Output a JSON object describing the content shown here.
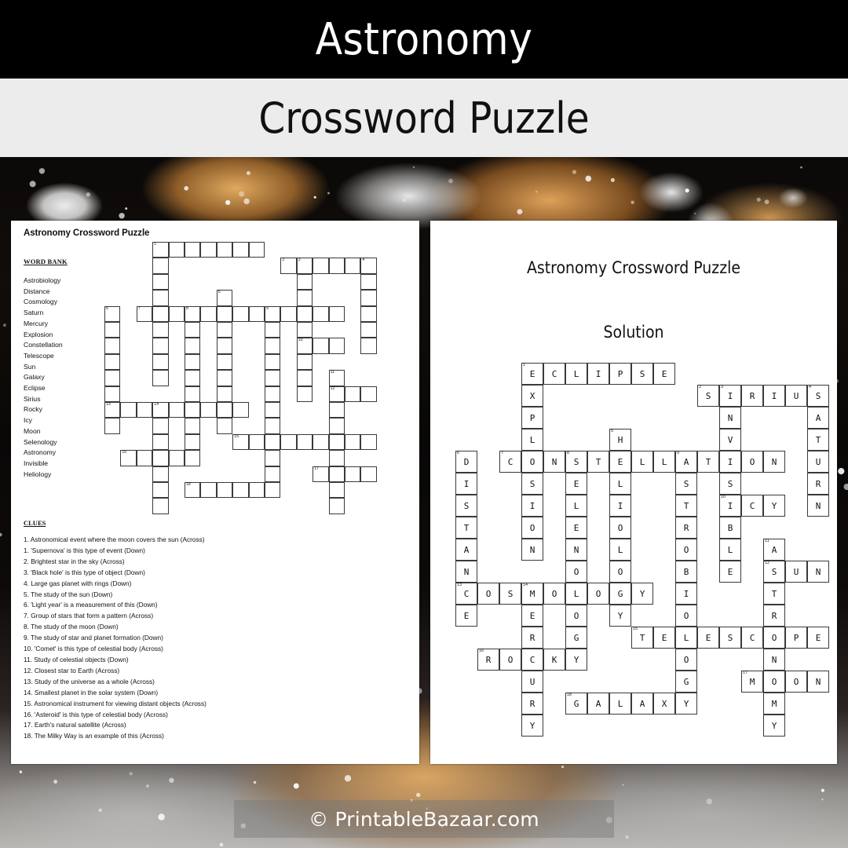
{
  "header": {
    "title": "Astronomy",
    "subtitle": "Crossword Puzzle"
  },
  "footer": {
    "watermark": "© PrintableBazaar.com"
  },
  "puzzle_sheet": {
    "title": "Astronomy Crossword Puzzle",
    "word_bank_heading": "WORD BANK",
    "word_bank": [
      "Astrobiology",
      "Distance",
      "Cosmology",
      "Saturn",
      "Mercury",
      "Explosion",
      "Constellation",
      "Telescope",
      "Sun",
      "Galaxy",
      "Eclipse",
      "Sirius",
      "Rocky",
      "Icy",
      "Moon",
      "Selenology",
      "Astronomy",
      "Invisible",
      "Heliology"
    ],
    "clues_heading": "CLUES",
    "clues": [
      "1. Astronomical event where the moon covers the sun (Across)",
      "1. 'Supernova' is this type of event (Down)",
      "2. Brightest star in the sky (Across)",
      "3. 'Black hole' is this type of object (Down)",
      "4. Large gas planet with rings (Down)",
      "5. The study of the sun (Down)",
      "6. 'Light year' is a measurement of this (Down)",
      "7. Group of stars that form a pattern (Across)",
      "8. The study of the moon (Down)",
      "9. The study of star and planet formation (Down)",
      "10. 'Comet' is this type of celestial body (Across)",
      "11. Study of celestial objects (Down)",
      "12. Closest star to Earth (Across)",
      "13. Study of the universe as a whole (Across)",
      "14. Smallest planet in the solar system (Down)",
      "15. Astronomical instrument for viewing distant objects (Across)",
      "16. 'Asteroid' is this type of celestial body (Across)",
      "17. Earth's natural satellite (Across)",
      "18. The Milky Way is an example of this (Across)"
    ]
  },
  "solution_sheet": {
    "title": "Astronomy Crossword Puzzle",
    "subtitle": "Solution"
  },
  "chart_data": {
    "type": "table",
    "title": "Astronomy Crossword Puzzle Solution Grid",
    "cell_size": 28,
    "grid_cols": 18,
    "grid_rows": 16,
    "entries": [
      {
        "number": 1,
        "answer": "ECLIPSE",
        "direction": "across",
        "row": 0,
        "col": 3,
        "clue": "Astronomical event where the moon covers the sun"
      },
      {
        "number": 1,
        "answer": "EXPLOSION",
        "direction": "down",
        "row": 0,
        "col": 3,
        "clue": "'Supernova' is this type of event"
      },
      {
        "number": 2,
        "answer": "SIRIUS",
        "direction": "across",
        "row": 1,
        "col": 11,
        "clue": "Brightest star in the sky"
      },
      {
        "number": 3,
        "answer": "INVISIBLE",
        "direction": "down",
        "row": 1,
        "col": 12,
        "clue": "'Black hole' is this type of object"
      },
      {
        "number": 4,
        "answer": "SATURN",
        "direction": "down",
        "row": 1,
        "col": 16,
        "clue": "Large gas planet with rings"
      },
      {
        "number": 5,
        "answer": "HELIOLOGY",
        "direction": "down",
        "row": 3,
        "col": 7,
        "clue": "The study of the sun"
      },
      {
        "number": 6,
        "answer": "DISTANCE",
        "direction": "down",
        "row": 4,
        "col": 0,
        "clue": "'Light year' is a measurement of this"
      },
      {
        "number": 7,
        "answer": "CONSTELLATION",
        "direction": "across",
        "row": 4,
        "col": 2,
        "clue": "Group of stars that form a pattern"
      },
      {
        "number": 8,
        "answer": "SELENOLOGY",
        "direction": "down",
        "row": 4,
        "col": 5,
        "clue": "The study of the moon"
      },
      {
        "number": 9,
        "answer": "ASTROBIOLOGY",
        "direction": "down",
        "row": 4,
        "col": 10,
        "clue": "The study of star and planet formation"
      },
      {
        "number": 10,
        "answer": "ICY",
        "direction": "across",
        "row": 6,
        "col": 12,
        "clue": "'Comet' is this type of celestial body"
      },
      {
        "number": 11,
        "answer": "ASTRONOMY",
        "direction": "down",
        "row": 8,
        "col": 14,
        "clue": "Study of celestial objects"
      },
      {
        "number": 12,
        "answer": "SUN",
        "direction": "across",
        "row": 9,
        "col": 14,
        "clue": "Closest star to Earth"
      },
      {
        "number": 13,
        "answer": "COSMOLOGY",
        "direction": "across",
        "row": 10,
        "col": 0,
        "clue": "Study of the universe as a whole"
      },
      {
        "number": 14,
        "answer": "MERCURY",
        "direction": "down",
        "row": 10,
        "col": 3,
        "clue": "Smallest planet in the solar system"
      },
      {
        "number": 15,
        "answer": "TELESCOPE",
        "direction": "across",
        "row": 12,
        "col": 8,
        "clue": "Astronomical instrument for viewing distant objects"
      },
      {
        "number": 16,
        "answer": "ROCKY",
        "direction": "across",
        "row": 13,
        "col": 1,
        "clue": "'Asteroid' is this type of celestial body"
      },
      {
        "number": 17,
        "answer": "MOON",
        "direction": "across",
        "row": 14,
        "col": 13,
        "clue": "Earth's natural satellite"
      },
      {
        "number": 18,
        "answer": "GALAXY",
        "direction": "across",
        "row": 15,
        "col": 5,
        "clue": "The Milky Way is an example of this"
      }
    ]
  }
}
